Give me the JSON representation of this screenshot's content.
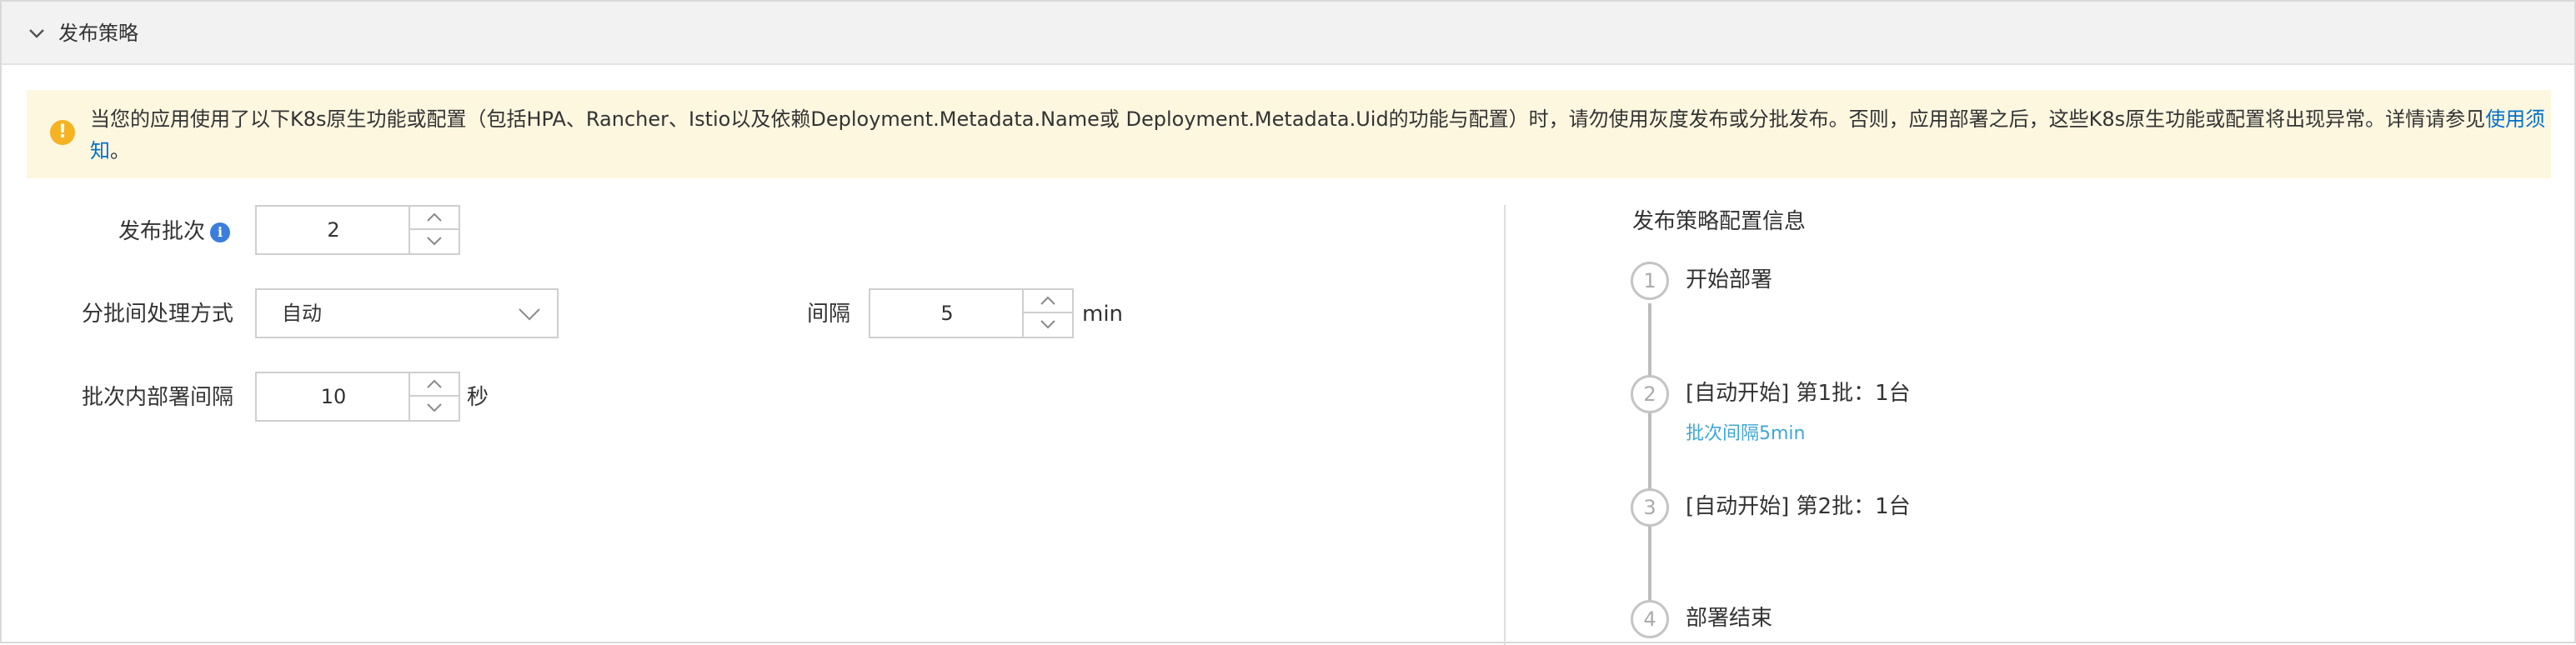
{
  "header": {
    "title": "发布策略"
  },
  "notice": {
    "text": "当您的应用使用了以下K8s原生功能或配置（包括HPA、Rancher、Istio以及依赖Deployment.Metadata.Name或 Deployment.Metadata.Uid的功能与配置）时，请勿使用灰度发布或分批发布。否则，应用部署之后，这些K8s原生功能或配置将出现异常。详情请参见",
    "link_text_1": "使用须",
    "link_text_2": "知",
    "end": "。"
  },
  "form": {
    "batches": {
      "label": "发布批次",
      "value": "2"
    },
    "batch_mode": {
      "label": "分批间处理方式",
      "value": "自动"
    },
    "interval": {
      "label": "间隔",
      "value": "5",
      "unit": "min"
    },
    "inner_interval": {
      "label": "批次内部署间隔",
      "value": "10",
      "unit": "秒"
    }
  },
  "strategy_info": {
    "title": "发布策略配置信息",
    "steps": [
      {
        "number": "1",
        "label": "开始部署",
        "sub": ""
      },
      {
        "number": "2",
        "label": "[自动开始] 第1批：1台",
        "sub": "批次间隔5min"
      },
      {
        "number": "3",
        "label": "[自动开始] 第2批：1台",
        "sub": ""
      },
      {
        "number": "4",
        "label": "部署结束",
        "sub": ""
      }
    ]
  },
  "colors": {
    "accent": "#0070cc",
    "notice_bg": "#fef7e0",
    "warning": "#f5b323",
    "info": "#3b7ddd",
    "timeline_sub": "#3fa7d6"
  },
  "icons": [
    "chevron-down-icon",
    "warning-icon",
    "info-icon",
    "caret-up-icon",
    "caret-down-icon"
  ]
}
